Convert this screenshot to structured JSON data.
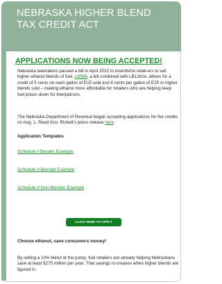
{
  "header": {
    "title_line1": "NEBRASKA HIGHER BLEND",
    "title_line2": "TAX CREDIT ACT"
  },
  "headline": "APPLICATIONS NOW BEING ACCEPTED!",
  "intro": {
    "part1": "Nebraska lawmakers passed a bill in April 2022 to incentivize retail-ers to sell higher ethanol blends of fuel. ",
    "link": "LB596",
    "part2": ", a bill combined with LB1261e, allows for a credit of 5 cents on each gallon of E15 sold and 8 cents per gallon of E25 or higher blends sold – making ethanol more affordable for retailers who are helping keep fuel prices down for theirpatrons."
  },
  "revenue": {
    "part1": "The Nebraska Department of Revenue began accepting applications for the credits on Aug. 1. Read Gov. Rickett's press release ",
    "link": "here",
    "part2": "."
  },
  "templates": {
    "heading": "Application Templates",
    "items": [
      "Schedule I Blender Example",
      "Schedule II Blender Example",
      "Schedule II Non-Blender Example"
    ]
  },
  "cta_button": "CLICK HERE TO APPLY",
  "subheading": "Choose ethanol, save consumers money!",
  "closing": "By selling a 10% blend at the pump, fuel retailers are already helping Nebraskans save at least $275 million per year. That savings in-creases when higher blends are figured in.",
  "colors": {
    "header_bg": "#8fb19a",
    "accent": "#1e8d2c",
    "button": "#0f7d22"
  }
}
